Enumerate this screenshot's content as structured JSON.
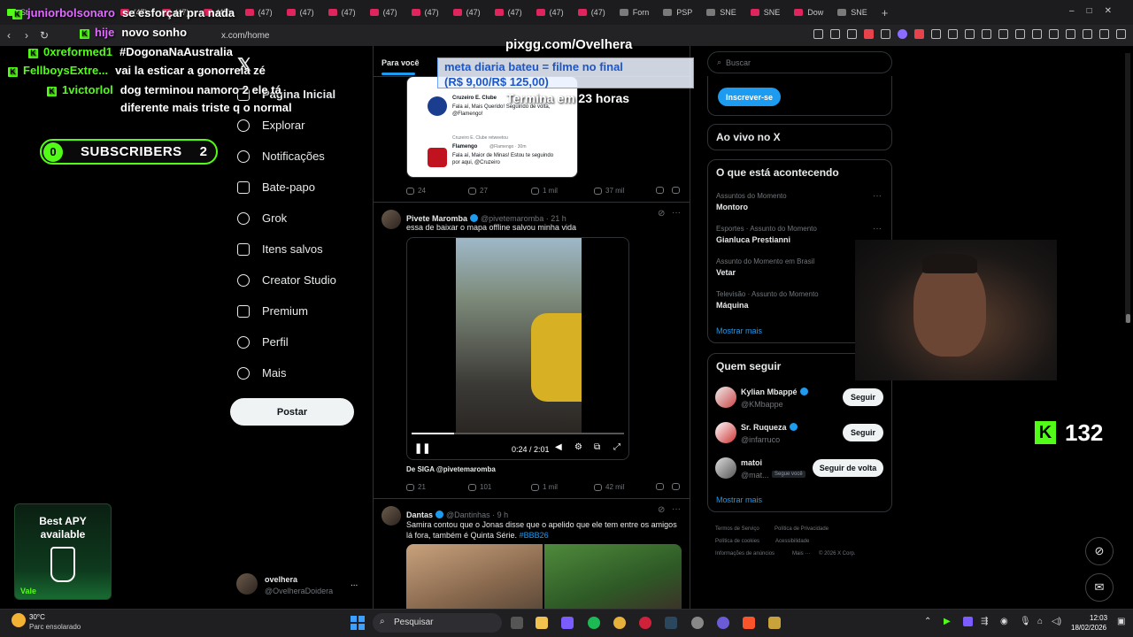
{
  "browser": {
    "tabs": [
      "St",
      "(47)",
      "(47)",
      "(47)",
      "(47)",
      "(47)",
      "(47)",
      "(47)",
      "(47)",
      "(47)",
      "(47)",
      "(47)",
      "(47)",
      "Forn",
      "PSP",
      "SNE",
      "SNE",
      "Dow",
      "SNE"
    ],
    "url": "x.com/home",
    "back": "‹",
    "forward": "›",
    "reload": "↻"
  },
  "overlay": {
    "chat": [
      {
        "user": "juniorbolsonaro",
        "user_color": "#e06cff",
        "text": "se esforçar pra nada"
      },
      {
        "user": "hije",
        "user_color": "#e06cff",
        "text": "novo sonho"
      },
      {
        "user": "0xreformed1",
        "user_color": "#53fc18",
        "text": "#DogonaNaAustralia"
      },
      {
        "user": "FellboysExtre...",
        "user_color": "#53fc18",
        "text": "vai la esticar a gonorreia zé"
      },
      {
        "user": "1victorlol",
        "user_color": "#53fc18",
        "text": "dog terminou namoro 2 ele tá"
      },
      {
        "user": "",
        "user_color": "#ffffff",
        "text": "diferente mais triste q o normal"
      }
    ],
    "subscribers": {
      "left": "0",
      "label": "SUBSCRIBERS",
      "right": "2"
    },
    "pix_url": "pixgg.com/Ovelhera",
    "goal_line1": "meta diaria bateu = filme no final",
    "goal_line2": "(R$ 9,00/R$ 125,00)",
    "goal_time": "Termina em 23 horas",
    "apy_line1": "Best APY",
    "apy_line2": "available",
    "apy_badge": "Vale",
    "viewers": "132"
  },
  "x": {
    "nav": [
      {
        "label": "Página Inicial",
        "icon": "home-icon"
      },
      {
        "label": "Explorar",
        "icon": "search-icon"
      },
      {
        "label": "Notificações",
        "icon": "bell-icon"
      },
      {
        "label": "Bate-papo",
        "icon": "mail-icon"
      },
      {
        "label": "Grok",
        "icon": "grok-icon"
      },
      {
        "label": "Itens salvos",
        "icon": "bookmark-icon"
      },
      {
        "label": "Creator Studio",
        "icon": "creator-icon"
      },
      {
        "label": "Premium",
        "icon": "x-premium-icon"
      },
      {
        "label": "Perfil",
        "icon": "person-icon"
      },
      {
        "label": "Mais",
        "icon": "more-icon"
      }
    ],
    "post_button": "Postar",
    "account": {
      "name": "ovelhera",
      "handle": "@OvelheraDoidera",
      "menu": "..."
    },
    "feed_tab": "Para você",
    "quoted": {
      "cruzeiro_name": "Cruzeiro E. Clube",
      "cruzeiro_text": "Fala aí, Mais Querido! Seguindo de volta, @Flamengo!",
      "retweeted": "Cruzeiro E. Clube retweetou",
      "flamengo_name": "Flamengo",
      "flamengo_meta": "@Flamengo · 30m",
      "flamengo_text": "Fala aí, Maior de Minas! Estou te seguindo por aqui, @Cruzeiro"
    },
    "tweet1_stats": {
      "replies": "24",
      "retweets": "27",
      "likes": "1 mil",
      "views": "37 mil"
    },
    "tweet2": {
      "name": "Pivete Maromba",
      "handle": "@pivetemaromba · 21 h",
      "text": "essa de baixar o mapa offline salvou minha vida",
      "video_time": "0:24 / 2:01",
      "from": "De SIGA @pivetemaromba",
      "stats": {
        "replies": "21",
        "retweets": "101",
        "likes": "1 mil",
        "views": "42 mil"
      }
    },
    "tweet3": {
      "name": "Dantas",
      "handle": "@Dantinhas · 9 h",
      "text": "Samira contou que o Jonas disse que o apelido que ele tem entre os amigos lá fora, também é Quinta Série.",
      "hashtag": "#BBB26"
    },
    "search_placeholder": "Buscar",
    "subscribe_button": "Inscrever-se",
    "live_title": "Ao vivo no X",
    "trends_title": "O que está acontecendo",
    "trends": [
      {
        "category": "Assuntos do Momento",
        "name": "Montoro"
      },
      {
        "category": "Esportes · Assunto do Momento",
        "name": "Gianluca Prestianni"
      },
      {
        "category": "Assunto do Momento em Brasil",
        "name": "Vetar"
      },
      {
        "category": "Televisão · Assunto do Momento",
        "name": "Máquina"
      }
    ],
    "show_more": "Mostrar mais",
    "who_to_follow": "Quem seguir",
    "follow_suggestions": [
      {
        "name": "Kylian Mbappé",
        "handle": "@KMbappe",
        "button": "Seguir"
      },
      {
        "name": "Sr. Ruqueza",
        "handle": "@infarruco",
        "button": "Seguir"
      },
      {
        "name": "matoi",
        "handle": "@mat...",
        "badge": "Segue você",
        "button": "Seguir de volta"
      }
    ],
    "show_more2": "Mostrar mais",
    "footer": [
      "Termos de Serviço",
      "Política de Privacidade",
      "Política de cookies",
      "Acessibilidade",
      "Informações de anúncios",
      "Mais ···",
      "© 2026 X Corp."
    ]
  },
  "taskbar": {
    "weather_temp": "30°C",
    "weather_desc": "Parc ensolarado",
    "search": "Pesquisar",
    "time": "12:03",
    "date": "18/02/2026"
  }
}
